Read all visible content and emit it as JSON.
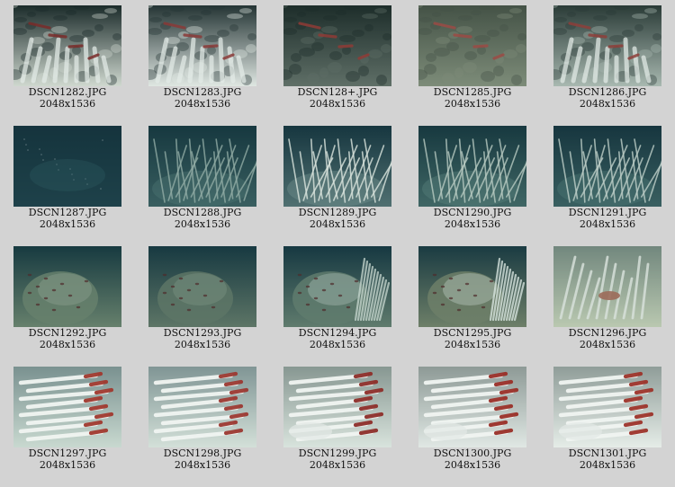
{
  "gallery": {
    "items": [
      {
        "filename": "DSCN1282.JPG",
        "dims": "2048x1536",
        "scene": "seafloor-rocks-tubeworms",
        "palette": [
          "#1b2b2a",
          "#cfd8cf",
          "#7a2c2a"
        ]
      },
      {
        "filename": "DSCN1283.JPG",
        "dims": "2048x1536",
        "scene": "tubeworm-cluster",
        "palette": [
          "#243434",
          "#dfe7e2",
          "#8a3a38"
        ]
      },
      {
        "filename": "DSCN128+.JPG",
        "dims": "2048x1536",
        "scene": "dark-rock-face",
        "palette": [
          "#1d2d2a",
          "#5f6f67",
          "#8f3b36"
        ]
      },
      {
        "filename": "DSCN1285.JPG",
        "dims": "2048x1536",
        "scene": "gravel-seafloor",
        "palette": [
          "#445246",
          "#7d8c79",
          "#9b4b45"
        ]
      },
      {
        "filename": "DSCN1286.JPG",
        "dims": "2048x1536",
        "scene": "rock-with-tubeworms",
        "palette": [
          "#2a3b37",
          "#a8b8b0",
          "#8e3f3a"
        ]
      },
      {
        "filename": "DSCN1287.JPG",
        "dims": "2048x1536",
        "scene": "murky-water",
        "palette": [
          "#15343d",
          "#2f5b62",
          "#4b6d6a"
        ]
      },
      {
        "filename": "DSCN1288.JPG",
        "dims": "2048x1536",
        "scene": "white-tubeworm-bush",
        "palette": [
          "#173840",
          "#4c7372",
          "#91aca5"
        ]
      },
      {
        "filename": "DSCN1289.JPG",
        "dims": "2048x1536",
        "scene": "white-tubeworm-bush",
        "palette": [
          "#173740",
          "#6f8f8c",
          "#dce6df"
        ]
      },
      {
        "filename": "DSCN1290.JPG",
        "dims": "2048x1536",
        "scene": "white-tubeworm-bush",
        "palette": [
          "#183940",
          "#567f79",
          "#b8cbc2"
        ]
      },
      {
        "filename": "DSCN1291.JPG",
        "dims": "2048x1536",
        "scene": "white-tubeworm-bush",
        "palette": [
          "#17363f",
          "#4c7673",
          "#bfd0c9"
        ]
      },
      {
        "filename": "DSCN1292.JPG",
        "dims": "2048x1536",
        "scene": "rock-mound",
        "palette": [
          "#173a40",
          "#66806c",
          "#9eb0a0"
        ]
      },
      {
        "filename": "DSCN1293.JPG",
        "dims": "2048x1536",
        "scene": "rock-mound",
        "palette": [
          "#173941",
          "#5d7566",
          "#8aa293"
        ]
      },
      {
        "filename": "DSCN1294.JPG",
        "dims": "2048x1536",
        "scene": "rock-mound-tubeworms",
        "palette": [
          "#163841",
          "#5f7b6d",
          "#c8d8d0"
        ]
      },
      {
        "filename": "DSCN1295.JPG",
        "dims": "2048x1536",
        "scene": "rock-mound-tubeworms",
        "palette": [
          "#1a3b42",
          "#6d7f68",
          "#ddeae5"
        ]
      },
      {
        "filename": "DSCN1296.JPG",
        "dims": "2048x1536",
        "scene": "crab-tubeworm-bed",
        "palette": [
          "#1b3940",
          "#b9c8b0",
          "#d9e2dc"
        ]
      },
      {
        "filename": "DSCN1297.JPG",
        "dims": "2048x1536",
        "scene": "red-tubeworms-white",
        "palette": [
          "#1b3b43",
          "#c9d9d0",
          "#a1392f"
        ]
      },
      {
        "filename": "DSCN1298.JPG",
        "dims": "2048x1536",
        "scene": "red-tubeworms-white",
        "palette": [
          "#1c3b43",
          "#d3e0d8",
          "#9c3932"
        ]
      },
      {
        "filename": "DSCN1299.JPG",
        "dims": "2048x1536",
        "scene": "red-tubeworms-close",
        "palette": [
          "#253b38",
          "#d8e3dd",
          "#8e2f2a"
        ]
      },
      {
        "filename": "DSCN1300.JPG",
        "dims": "2048x1536",
        "scene": "red-tubeworms-close",
        "palette": [
          "#2a3d39",
          "#e0e8e4",
          "#9a3028"
        ]
      },
      {
        "filename": "DSCN1301.JPG",
        "dims": "2048x1536",
        "scene": "red-tubeworms-close",
        "palette": [
          "#283d3a",
          "#e5ece8",
          "#9d342b"
        ]
      }
    ]
  }
}
